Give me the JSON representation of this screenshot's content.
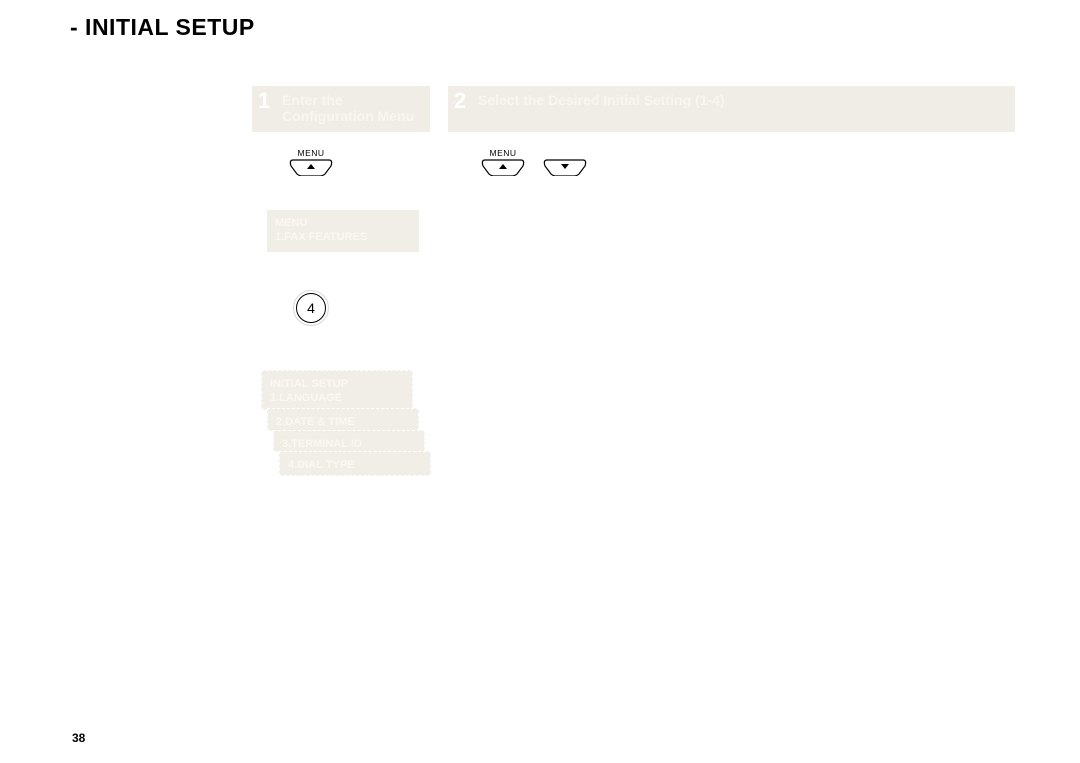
{
  "title": "- INITIAL SETUP",
  "step1": {
    "num": "1",
    "line1": "Enter the",
    "line2": "Configuration Menu"
  },
  "step2": {
    "num": "2",
    "line1": "Select the Desired Initial Setting (1-4)"
  },
  "buttons": {
    "menu_label": "MENU",
    "numeric_key": "4"
  },
  "lcd": {
    "a1": "MENU",
    "a2": "1.FAX FEATURES",
    "b1": "INITIAL SETUP",
    "b2": "1.LANGUAGE",
    "c1": "2.DATE & TIME",
    "d1": "3.TERMINAL ID",
    "e1": "4.DIAL TYPE"
  },
  "page_number": "38"
}
